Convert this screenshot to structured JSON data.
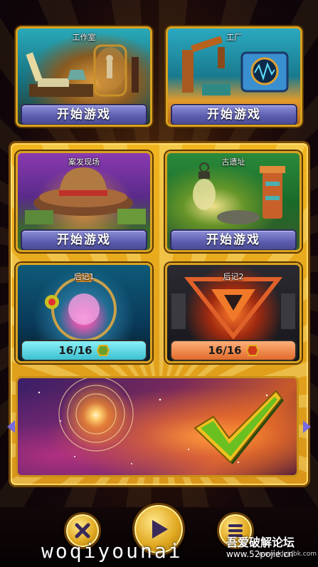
{
  "levels": [
    {
      "title": "工作室",
      "button": "开始游戏"
    },
    {
      "title": "工厂",
      "button": "开始游戏"
    },
    {
      "title": "案发现场",
      "button": "开始游戏"
    },
    {
      "title": "古遗址",
      "button": "开始游戏"
    }
  ],
  "epilogues": [
    {
      "title": "后记1",
      "progress": "16/16",
      "color": "#4fd6e0"
    },
    {
      "title": "后记2",
      "progress": "16/16",
      "color": "#f08a3a"
    }
  ],
  "controls": {
    "close_icon": "close-icon",
    "play_icon": "play-icon",
    "menu_icon": "menu-icon",
    "confirm_icon": "checkmark-icon"
  },
  "watermark": {
    "text": "woqiyounai",
    "forum": "吾爱破解论坛",
    "site": "www.52pojie.cn",
    "site2": "www.ddyjdbk.com"
  }
}
